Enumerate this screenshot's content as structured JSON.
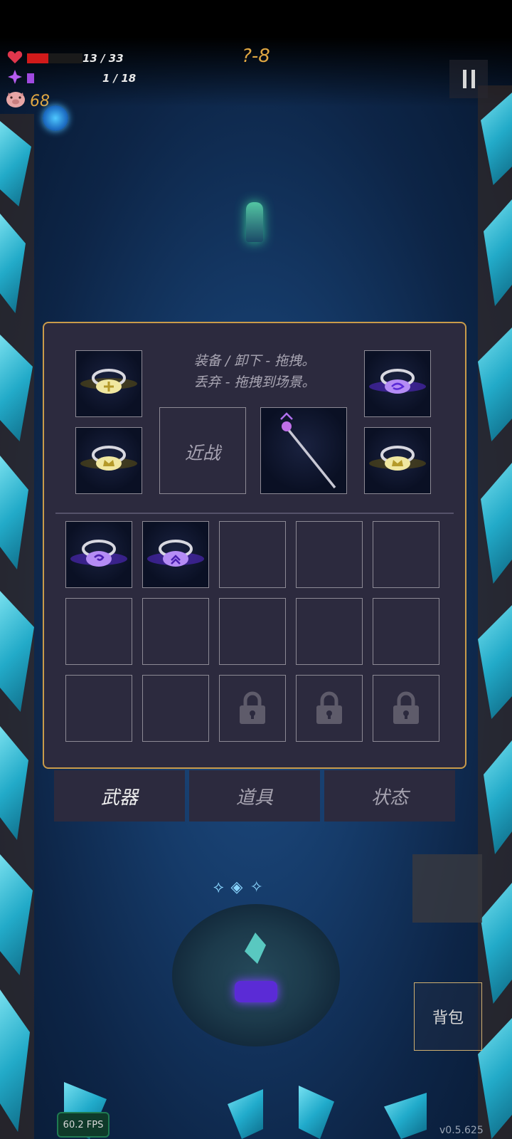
{
  "hud": {
    "health_text": "13 / 33",
    "health_fraction": 0.39,
    "health_color": "#d11a1a",
    "mana_text": "1 / 18",
    "mana_fraction": 0.06,
    "mana_color": "#a04ae0",
    "coins": "68",
    "level": "?-8",
    "icons": [
      "heart-icon",
      "mana-crystal-icon",
      "pig-coin-icon",
      "pause-icon"
    ]
  },
  "inventory": {
    "instructions_line1": "装备 / 卸下 - 拖拽。",
    "instructions_line2": "丢弃 - 拖拽到场景。",
    "melee_label": "近战",
    "equipped_rings": [
      {
        "icon": "gold-cross-ring-icon",
        "gem_color": "#e8d36a"
      },
      {
        "icon": "gold-crown-ring-icon",
        "gem_color": "#e8d36a"
      },
      {
        "icon": "purple-rune-ring-icon",
        "gem_color": "#b07dff"
      },
      {
        "icon": "gold-crown-ring-icon",
        "gem_color": "#e8d36a"
      }
    ],
    "weapon_icon": "magic-staff-icon",
    "bag_rings": [
      {
        "icon": "purple-swirl-ring-icon",
        "gem_color": "#b07dff"
      },
      {
        "icon": "purple-chevron-ring-icon",
        "gem_color": "#b07dff"
      }
    ],
    "locked_slots": 3,
    "lock_icon": "padlock-icon"
  },
  "tabs": [
    {
      "label": "武器",
      "active": true
    },
    {
      "label": "道具",
      "active": false
    },
    {
      "label": "状态",
      "active": false
    }
  ],
  "bag_button": "背包",
  "fps": "60.2 FPS",
  "version": "v0.5.625",
  "colors": {
    "panel_bg": "#2c2a3e",
    "panel_border": "#c99b4a",
    "accent_gold": "#e0a742"
  }
}
